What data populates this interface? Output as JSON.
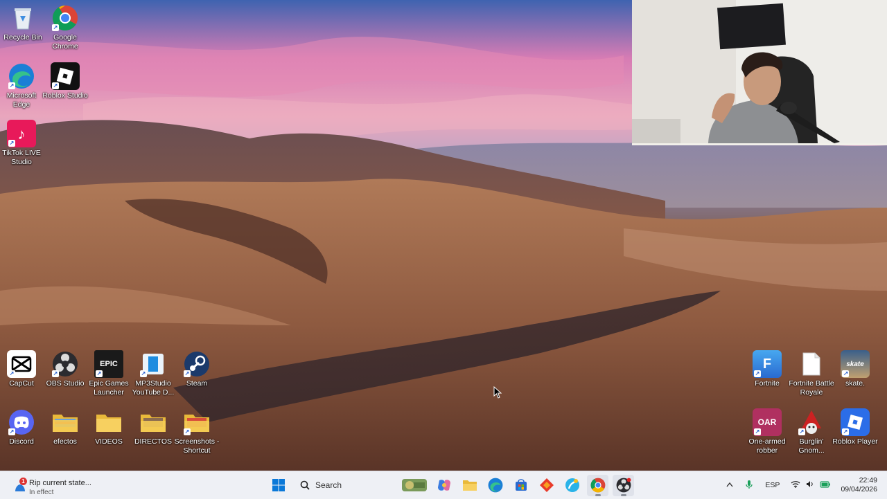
{
  "desktop": {
    "left_icons": [
      {
        "label": "Recycle Bin",
        "icon": "recycle-bin-icon"
      },
      {
        "label": "Google Chrome",
        "icon": "chrome-icon"
      },
      {
        "label": "Microsoft Edge",
        "icon": "edge-icon"
      },
      {
        "label": "Roblox Studio",
        "icon": "roblox-studio-icon"
      },
      {
        "label": "TikTok LIVE Studio",
        "icon": "tiktok-icon"
      }
    ],
    "bottom_row1": [
      {
        "label": "CapCut",
        "icon": "capcut-icon"
      },
      {
        "label": "OBS Studio",
        "icon": "obs-icon"
      },
      {
        "label": "Epic Games Launcher",
        "icon": "epic-games-icon"
      },
      {
        "label": "MP3Studio YouTube D...",
        "icon": "mp3studio-icon"
      },
      {
        "label": "Steam",
        "icon": "steam-icon"
      }
    ],
    "bottom_row2": [
      {
        "label": "Discord",
        "icon": "discord-icon"
      },
      {
        "label": "efectos",
        "icon": "folder-icon"
      },
      {
        "label": "VIDEOS",
        "icon": "folder-icon"
      },
      {
        "label": "DIRECTOS",
        "icon": "folder-icon"
      },
      {
        "label": "Screenshots - Shortcut",
        "icon": "folder-icon"
      }
    ],
    "right_row1": [
      {
        "label": "Fortnite",
        "icon": "fortnite-icon"
      },
      {
        "label": "Fortnite Battle Royale",
        "icon": "file-icon"
      },
      {
        "label": "skate.",
        "icon": "skate-icon"
      }
    ],
    "right_row2": [
      {
        "label": "One-armed robber",
        "icon": "one-armed-robber-icon"
      },
      {
        "label": "Burglin' Gnom...",
        "icon": "burglin-gnomes-icon"
      },
      {
        "label": "Roblox Player",
        "icon": "roblox-player-icon"
      }
    ],
    "glyphs": {
      "epic": "EPIC",
      "fortnite": "F",
      "skate": "skate",
      "robber": "OAR",
      "tiktok": "♪",
      "roblox": "▣",
      "shortcut": "↗"
    }
  },
  "taskbar": {
    "notification": {
      "title": "Rip current state...",
      "subtitle": "In effect",
      "badge": "1"
    },
    "search_placeholder": "Search",
    "pinned": [
      "windows-start-icon",
      "search",
      "widgets-icon",
      "copilot-icon",
      "file-explorer-icon",
      "edge-icon",
      "store-icon",
      "app-red-icon",
      "tiktok-live-icon",
      "chrome-icon",
      "obs-icon"
    ],
    "tray": {
      "language": "ESP",
      "time": "22:49",
      "date": "09/04/2026"
    }
  },
  "colors": {
    "taskbar_bg": "#eef0f5",
    "accent": "#0067c0"
  }
}
